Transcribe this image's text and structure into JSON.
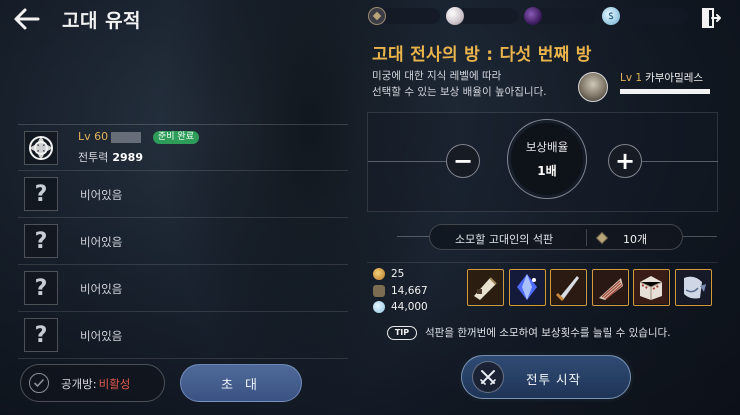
{
  "header": {
    "title": "고대 유적",
    "back_icon": "back-arrow-icon",
    "exit_icon": "exit-door-icon",
    "resources": [
      {
        "name": "ancient-stone",
        "icon": "stone-icon",
        "color": "#8a7a5c"
      },
      {
        "name": "pearl",
        "icon": "pearl-icon",
        "color": "#d8d2d6"
      },
      {
        "name": "dark-orb",
        "icon": "orb-icon",
        "color": "#4b2a6c"
      },
      {
        "name": "silver",
        "icon": "silver-coin-icon",
        "color": "#a9d6ea"
      }
    ]
  },
  "party": {
    "members": [
      {
        "level": "Lv 60",
        "status": "준비 완료",
        "power_label": "전투력",
        "power": "2989"
      }
    ],
    "empty_slots": [
      "비어있음",
      "비어있음",
      "비어있음",
      "비어있음"
    ]
  },
  "footer_left": {
    "public_label": "공개방:",
    "public_value": "비활성",
    "invite_label": "초 대"
  },
  "room": {
    "title": "고대 전사의 방 : 다섯 번째 방",
    "desc_line1": "미궁에 대한 지식 레벨에 따라",
    "desc_line2": "선택할 수 있는 보상 배율이 높아집니다.",
    "rep_level": "Lv 1",
    "rep_name": "카부아밀레스"
  },
  "multiplier": {
    "label": "보상배율",
    "value": "1배",
    "minus": "−",
    "plus": "+"
  },
  "consume": {
    "label": "소모할 고대인의 석판",
    "count": "10개"
  },
  "currencies": [
    {
      "icon": "gold-coin-icon",
      "value": "25",
      "color": "#d9a34a"
    },
    {
      "icon": "exp-icon",
      "value": "14,667",
      "color": "#a08a66"
    },
    {
      "icon": "silver-coin-icon",
      "value": "44,000",
      "color": "#9fd0e6"
    }
  ],
  "rewards": [
    {
      "icon": "scroll-item-icon"
    },
    {
      "icon": "crystal-item-icon"
    },
    {
      "icon": "dagger-item-icon"
    },
    {
      "icon": "fan-item-icon"
    },
    {
      "icon": "chest-item-icon"
    },
    {
      "icon": "gauntlet-item-icon"
    }
  ],
  "tip": {
    "badge": "TIP",
    "text": "석판을 한꺼번에 소모하여 보상횟수를 늘릴 수 있습니다."
  },
  "start": {
    "label": "전투 시작"
  }
}
